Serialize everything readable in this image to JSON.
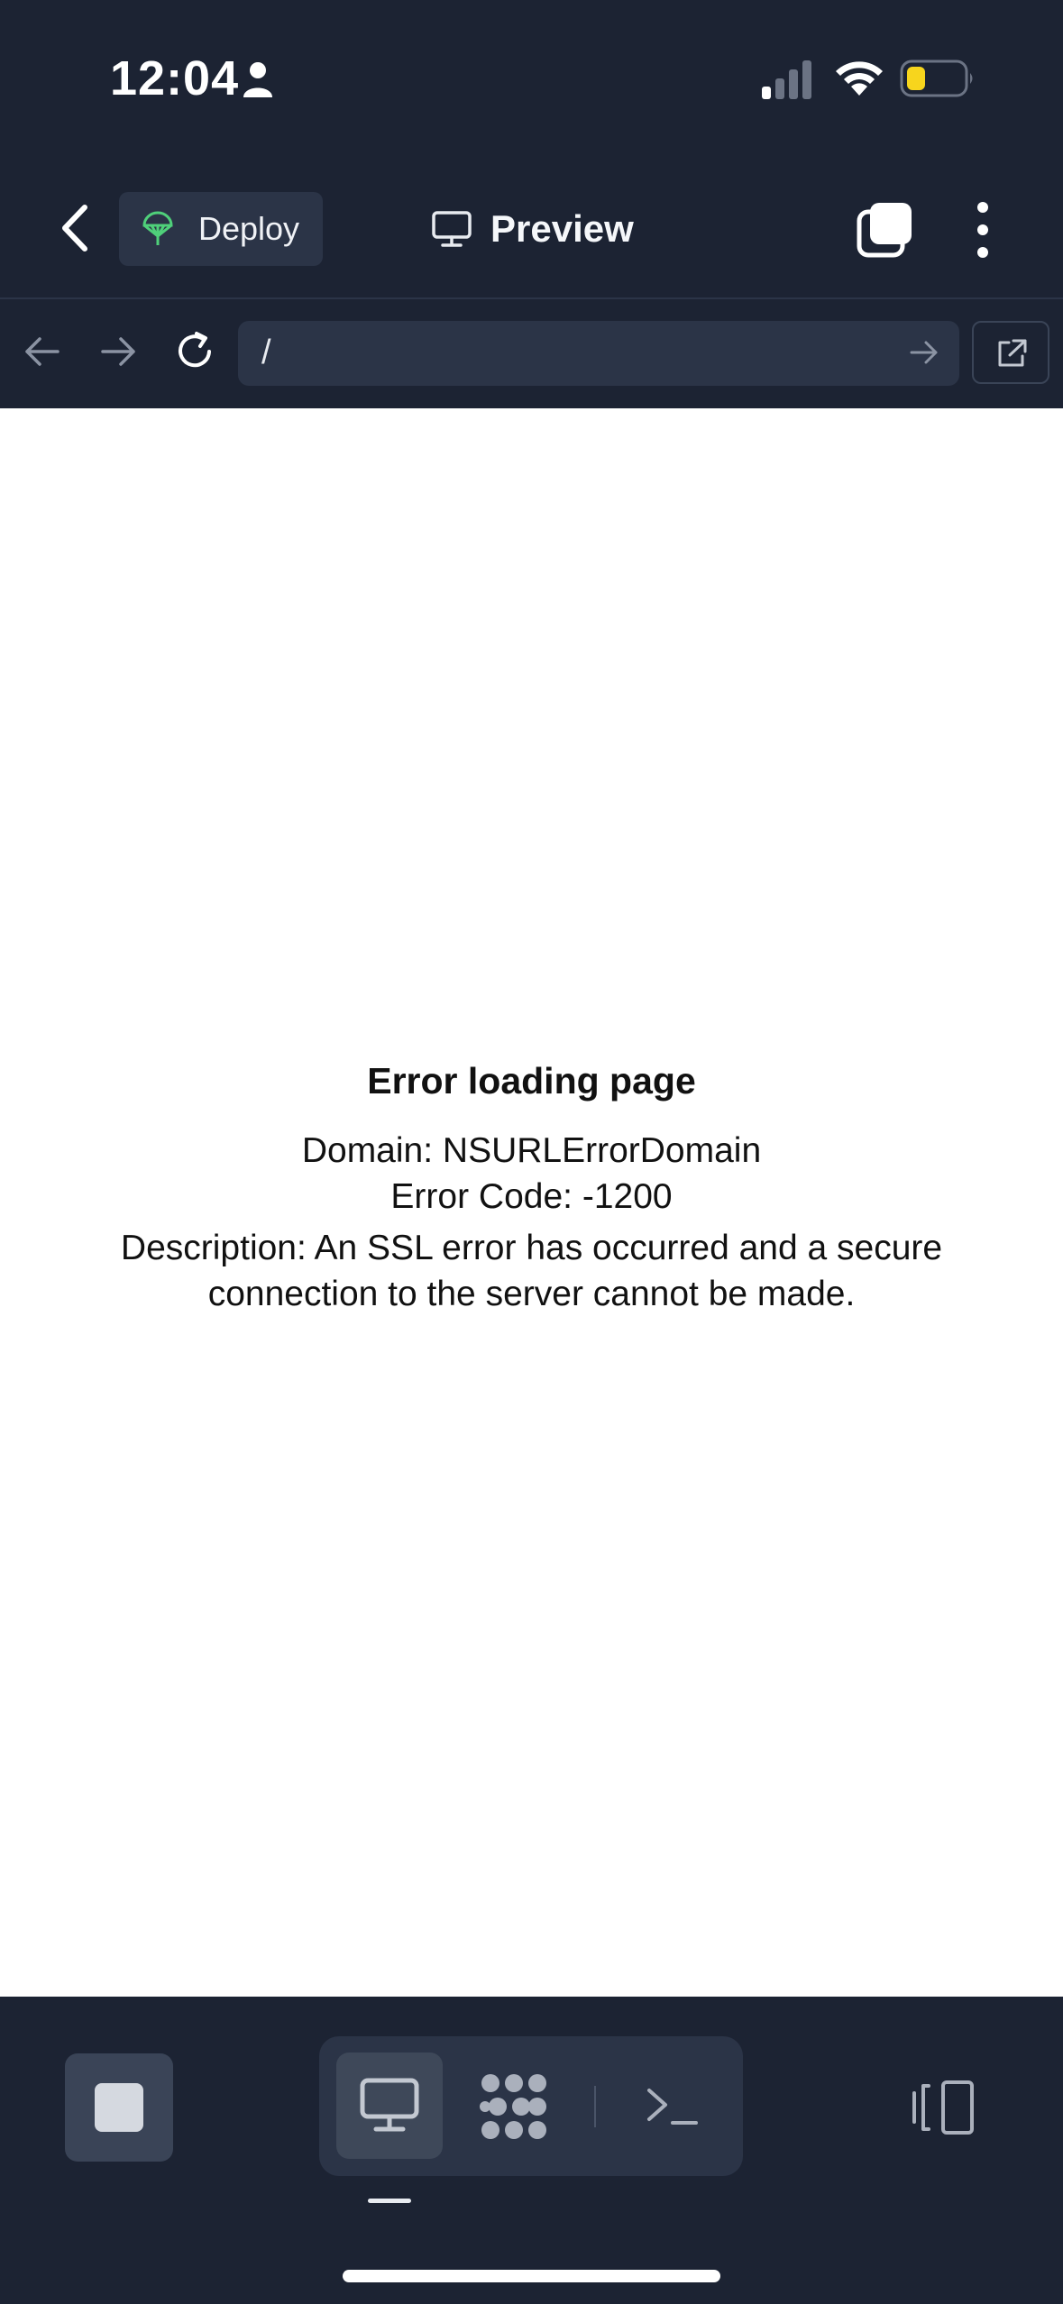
{
  "status_bar": {
    "time": "12:04",
    "battery_color": "#f7d51d"
  },
  "header": {
    "deploy_label": "Deploy",
    "title": "Preview",
    "deploy_icon_color": "#4fd07a"
  },
  "url_bar": {
    "path": "/"
  },
  "error": {
    "title": "Error loading page",
    "domain_line": "Domain: NSURLErrorDomain",
    "code_line": "Error Code: -1200",
    "description_line": "Description: An SSL error has occurred and a secure connection to the server cannot be made."
  },
  "toolbar": {
    "modes": [
      "preview-icon",
      "packages-icon",
      "console-icon"
    ],
    "active_mode": "preview-icon"
  }
}
